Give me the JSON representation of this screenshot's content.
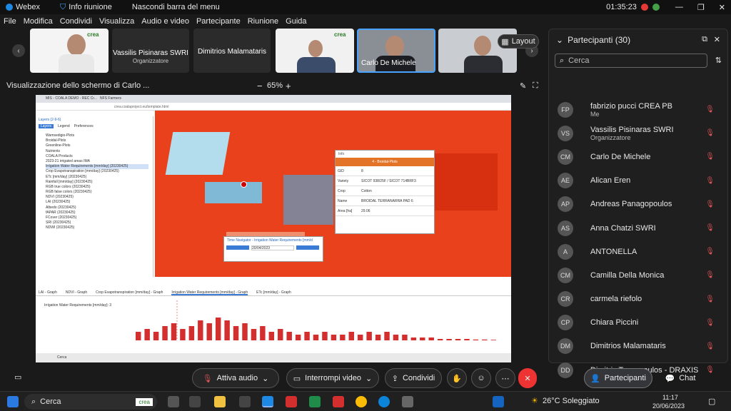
{
  "titlebar": {
    "app": "Webex",
    "info": "Info riunione",
    "hide": "Nascondi barra del menu",
    "time": "01:35:23"
  },
  "menu": [
    "File",
    "Modifica",
    "Condividi",
    "Visualizza",
    "Audio e video",
    "Partecipante",
    "Riunione",
    "Guida"
  ],
  "tiles": [
    {
      "name": "Vassilis Pisinaras SWRI",
      "sub": "Organizzatore"
    },
    {
      "name": "Dimitrios Malamataris",
      "sub": ""
    },
    {
      "name": "Carlo De Michele",
      "sub": ""
    }
  ],
  "layout_label": "Layout",
  "share": {
    "title": "Visualizzazione dello schermo di Carlo ...",
    "zoom": "65%"
  },
  "panel": {
    "title": "Partecipanti (30)",
    "search_placeholder": "Cerca"
  },
  "participants": [
    {
      "initials": "FP",
      "name": "fabrizio pucci CREA PB",
      "sub": "Me"
    },
    {
      "initials": "VS",
      "name": "Vassilis Pisinaras SWRI",
      "sub": "Organizzatore"
    },
    {
      "initials": "CM",
      "name": "Carlo De Michele",
      "sub": ""
    },
    {
      "initials": "AE",
      "name": "Alican Eren",
      "sub": ""
    },
    {
      "initials": "AP",
      "name": "Andreas Panagopoulos",
      "sub": ""
    },
    {
      "initials": "AS",
      "name": "Anna Chatzi SWRI",
      "sub": ""
    },
    {
      "initials": "A",
      "name": "ANTONELLA",
      "sub": ""
    },
    {
      "initials": "CM",
      "name": "Camilla Della Monica",
      "sub": ""
    },
    {
      "initials": "CR",
      "name": "carmela riefolo",
      "sub": ""
    },
    {
      "initials": "CP",
      "name": "Chiara Piccini",
      "sub": ""
    },
    {
      "initials": "DM",
      "name": "Dimitrios Malamataris",
      "sub": ""
    },
    {
      "initials": "DD",
      "name": "Dimitris Tassopoulos - DRAXIS",
      "sub": ""
    }
  ],
  "controls": {
    "mute": "Attiva audio",
    "video": "Interrompi video",
    "share": "Condividi",
    "participants": "Partecipanti",
    "chat": "Chat"
  },
  "taskbar": {
    "search": "Cerca",
    "weather": "26°C Soleggiato",
    "time": "11:17",
    "date": "20/06/2023"
  },
  "gis": {
    "url": "crea.coalaproject.eu/template.html",
    "tab1": "MIS - COALA DEMO - REC Cr...",
    "tab2": "NFS Farmers",
    "layers_title": "Layers (2-9-6)",
    "layer_tabs": [
      "Layers",
      "Legend",
      "Preferences"
    ],
    "layers": [
      "Wamsedigio-Plots",
      "Broidal-Plots",
      "Greenline-Plots",
      "Nutrients",
      "COALA Products",
      "2023-21 irrigated areas IMA",
      "Irrigation Water Requirements [mm/day] (20230425)",
      "Crop Evapotranspiration [mm/day] (20230425)",
      "ETc [mm/day] (20230425)",
      "Rainfall [mm/day] (20230425)",
      "RGB true colors (20230425)",
      "RGB false colors (20230425)",
      "NDVI (20230425)",
      "LAI (20230425)",
      "Albedo (20230425)",
      "fAPAR (20230425)",
      "FCover (20230425)",
      "SRI (20230425)",
      "NDWI (20230425)"
    ],
    "info_title": "4 - Broidal-Plots",
    "info_rows": [
      [
        "GID",
        "8"
      ],
      [
        "Variety",
        "SICOT 938/25F / SICOT 714BRF3"
      ],
      [
        "Crop",
        "Cotton"
      ],
      [
        "Name",
        "BROIDAL TERRANARRA PAD 6"
      ],
      [
        "Area [ha]",
        "29.06"
      ]
    ],
    "time_nav_title": "Time Navigator - Irrigation Water Requirements [mm/d",
    "date": "20/04/2023",
    "graph_tabs": [
      "LAI - Graph",
      "NDVI - Graph",
      "Crop Evapotranspiration [mm/day] - Graph",
      "Irrigation Water Requirements [mm/day] - Graph",
      "ETc [mm/day] - Graph"
    ],
    "graph_legend": "Irrigation Water Requirements [mm/day]: 3"
  },
  "chart_data": {
    "type": "bar",
    "title": "",
    "series": [
      {
        "name": "Irrigation Water Requirements [mm/day]",
        "values": [
          0.3,
          0.4,
          0.3,
          0.5,
          0.6,
          0.4,
          0.5,
          0.7,
          0.6,
          0.8,
          0.7,
          0.5,
          0.6,
          0.4,
          0.5,
          0.3,
          0.4,
          0.3,
          0.2,
          0.3,
          0.2,
          0.3,
          0.2,
          0.2,
          0.3,
          0.2,
          0.3,
          0.2,
          0.3,
          0.2,
          0.2,
          0.1,
          0.1,
          0.1,
          0.05,
          0.05,
          0.05,
          0.05,
          0.03,
          0.03,
          0.02
        ]
      }
    ]
  }
}
